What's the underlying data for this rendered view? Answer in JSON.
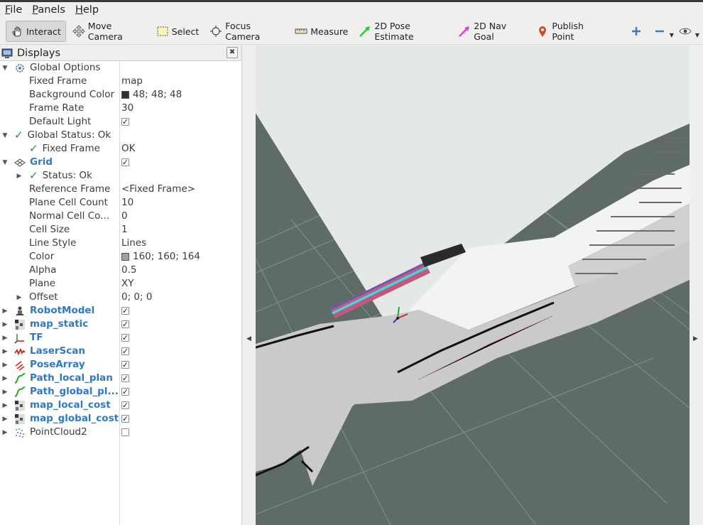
{
  "menu": [
    "File",
    "Panels",
    "Help"
  ],
  "toolbar": {
    "tools": [
      {
        "label": "Interact",
        "icon": "hand-icon",
        "active": true
      },
      {
        "label": "Move Camera",
        "icon": "move-camera-icon"
      },
      {
        "label": "Select",
        "icon": "select-icon"
      },
      {
        "label": "Focus Camera",
        "icon": "focus-camera-icon"
      },
      {
        "label": "Measure",
        "icon": "ruler-icon"
      },
      {
        "label": "2D Pose Estimate",
        "icon": "pose-estimate-arrow-icon",
        "color": "#2ecc2e"
      },
      {
        "label": "2D Nav Goal",
        "icon": "nav-goal-arrow-icon",
        "color": "#e83ad6"
      },
      {
        "label": "Publish Point",
        "icon": "map-pin-icon",
        "color": "#d9472b"
      }
    ]
  },
  "displays": {
    "title": "Displays",
    "global_options": {
      "label": "Global Options",
      "fixed_frame": {
        "name": "Fixed Frame",
        "value": "map"
      },
      "background_color": {
        "name": "Background Color",
        "value": "48; 48; 48",
        "swatch": "#303030"
      },
      "frame_rate": {
        "name": "Frame Rate",
        "value": "30"
      },
      "default_light": {
        "name": "Default Light"
      }
    },
    "global_status": {
      "label": "Global Status: Ok",
      "fixed_frame": {
        "name": "Fixed Frame",
        "value": "OK"
      }
    },
    "grid": {
      "label": "Grid",
      "status": "Status: Ok",
      "reference_frame": {
        "name": "Reference Frame",
        "value": "<Fixed Frame>"
      },
      "plane_cell_count": {
        "name": "Plane Cell Count",
        "value": "10"
      },
      "normal_cell_count": {
        "name": "Normal Cell Co...",
        "value": "0"
      },
      "cell_size": {
        "name": "Cell Size",
        "value": "1"
      },
      "line_style": {
        "name": "Line Style",
        "value": "Lines"
      },
      "color": {
        "name": "Color",
        "value": "160; 160; 164",
        "swatch": "#a0a0a4"
      },
      "alpha": {
        "name": "Alpha",
        "value": "0.5"
      },
      "plane": {
        "name": "Plane",
        "value": "XY"
      },
      "offset": {
        "name": "Offset",
        "value": "0; 0; 0"
      }
    },
    "plugins": [
      {
        "label": "RobotModel",
        "icon": "robot-model-icon",
        "checked": true
      },
      {
        "label": "map_static",
        "icon": "map-icon",
        "checked": true
      },
      {
        "label": "TF",
        "icon": "tf-axes-icon",
        "checked": true
      },
      {
        "label": "LaserScan",
        "icon": "laser-scan-icon",
        "checked": true
      },
      {
        "label": "PoseArray",
        "icon": "pose-array-icon",
        "checked": true
      },
      {
        "label": "Path_local_plan",
        "icon": "path-icon",
        "checked": true
      },
      {
        "label": "Path_global_pl...",
        "icon": "path-icon",
        "checked": true
      },
      {
        "label": "map_local_cost",
        "icon": "map-icon",
        "checked": true
      },
      {
        "label": "map_global_cost",
        "icon": "map-icon",
        "checked": true
      },
      {
        "label": "PointCloud2",
        "icon": "point-cloud-icon",
        "checked": false
      }
    ]
  },
  "viewport": {
    "background": "#5f6b68",
    "map_free_color": "#ebeded",
    "map_grey_color": "#c9c9c9",
    "costmap_color": "#d64a7c",
    "plan_color": "#3fd7e8"
  }
}
